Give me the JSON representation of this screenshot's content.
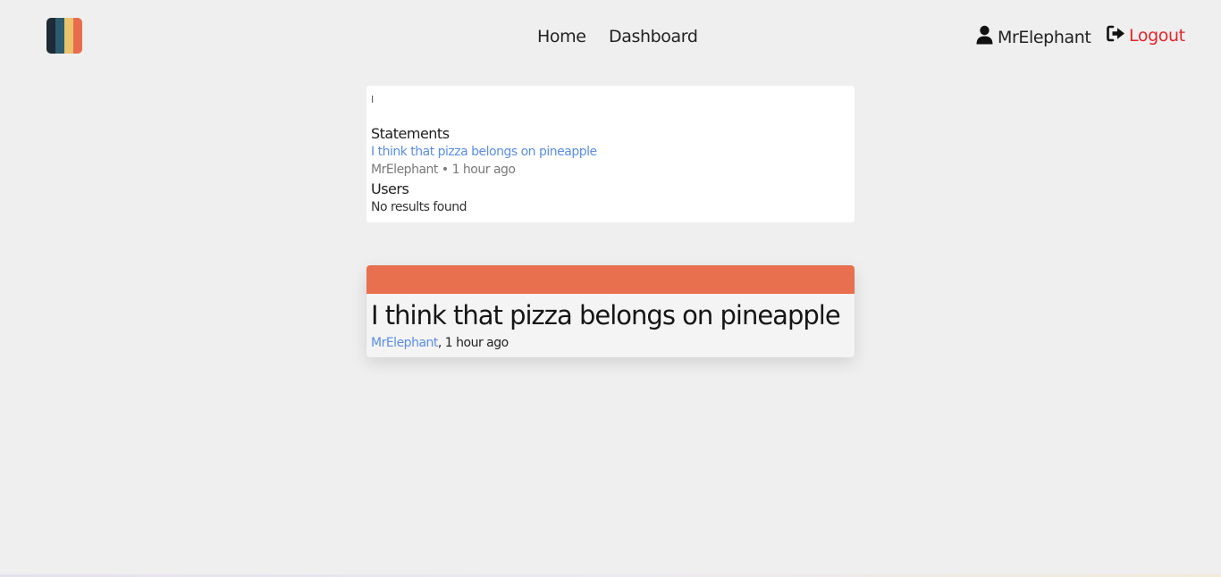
{
  "brand": {
    "logo_colors": [
      "#1c2b36",
      "#2d5b6e",
      "#eac36a",
      "#e86d4e"
    ]
  },
  "nav": {
    "home_label": "Home",
    "dashboard_label": "Dashboard",
    "username": "MrElephant",
    "logout_label": "Logout",
    "logout_color": "#e4252a",
    "user_icon": "user-icon",
    "logout_icon": "sign-out-icon"
  },
  "search": {
    "value": "I",
    "statements_heading": "Statements",
    "statement_results": [
      {
        "title": "I think that pizza belongs on pineapple",
        "author": "MrElephant",
        "separator": "•",
        "time": "1 hour ago"
      }
    ],
    "users_heading": "Users",
    "users_empty": "No results found"
  },
  "statement_card": {
    "accent_color": "#e8704f",
    "title": "I think that pizza belongs on pineapple",
    "author": "MrElephant",
    "time_suffix": ", 1 hour ago"
  }
}
